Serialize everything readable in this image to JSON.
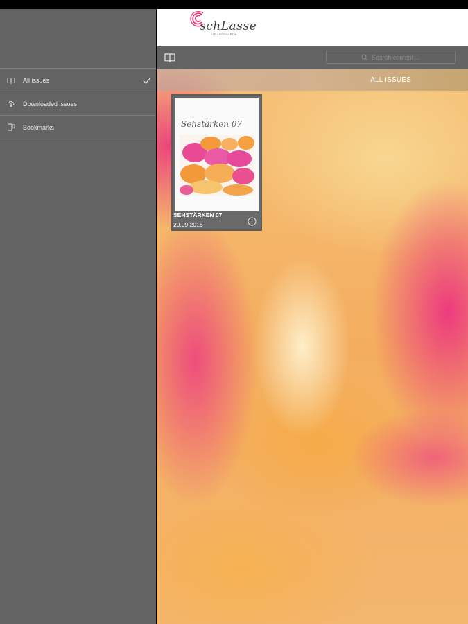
{
  "sidebar": {
    "items": [
      {
        "label": "All issues",
        "icon": "book-icon",
        "selected": true
      },
      {
        "label": "Downloaded issues",
        "icon": "cloud-download-icon",
        "selected": false
      },
      {
        "label": "Bookmarks",
        "icon": "bookmark-icon",
        "selected": false
      }
    ]
  },
  "header": {
    "logo_text": "schLasse",
    "logo_subtitle": "DIE AUGENOPTIK"
  },
  "toolbar": {
    "search_placeholder": "Search content ..."
  },
  "main": {
    "section_title": "ALL ISSUES",
    "issues": [
      {
        "cover_title": "Sehstärken 07",
        "title": "SEHSTÄRKEN 07",
        "date": "20.09.2016"
      }
    ]
  },
  "colors": {
    "sidebar_bg": "#636363",
    "brand_pink": "#e8336f",
    "header_bg": "#ffffff"
  }
}
